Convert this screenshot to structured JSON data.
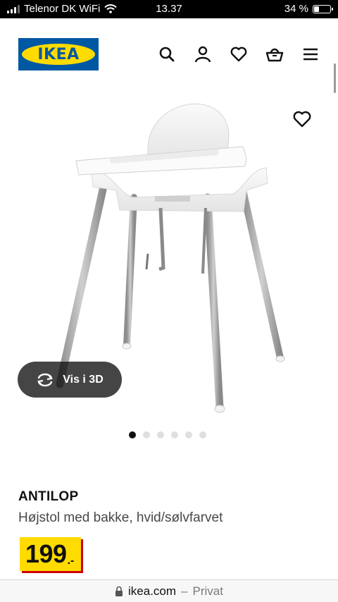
{
  "status_bar": {
    "carrier": "Telenor DK WiFi",
    "time": "13.37",
    "battery_text": "34 %",
    "battery_level": 0.34
  },
  "header": {
    "logo_text": "IKEA",
    "icons": [
      "search-icon",
      "user-icon",
      "heart-icon",
      "basket-icon",
      "menu-icon"
    ]
  },
  "gallery": {
    "view_3d_label": "Vis i 3D",
    "image_count": 6,
    "active_index": 0
  },
  "product": {
    "name": "ANTILOP",
    "description": "Højstol med bakke, hvid/sølvfarvet",
    "price_integer": "199",
    "price_decimals": ".-"
  },
  "browser": {
    "domain": "ikea.com",
    "separator": "–",
    "mode": "Privat"
  },
  "colors": {
    "ikea_blue": "#0058a3",
    "ikea_yellow": "#ffdb00",
    "price_shadow_red": "#cc0008"
  }
}
